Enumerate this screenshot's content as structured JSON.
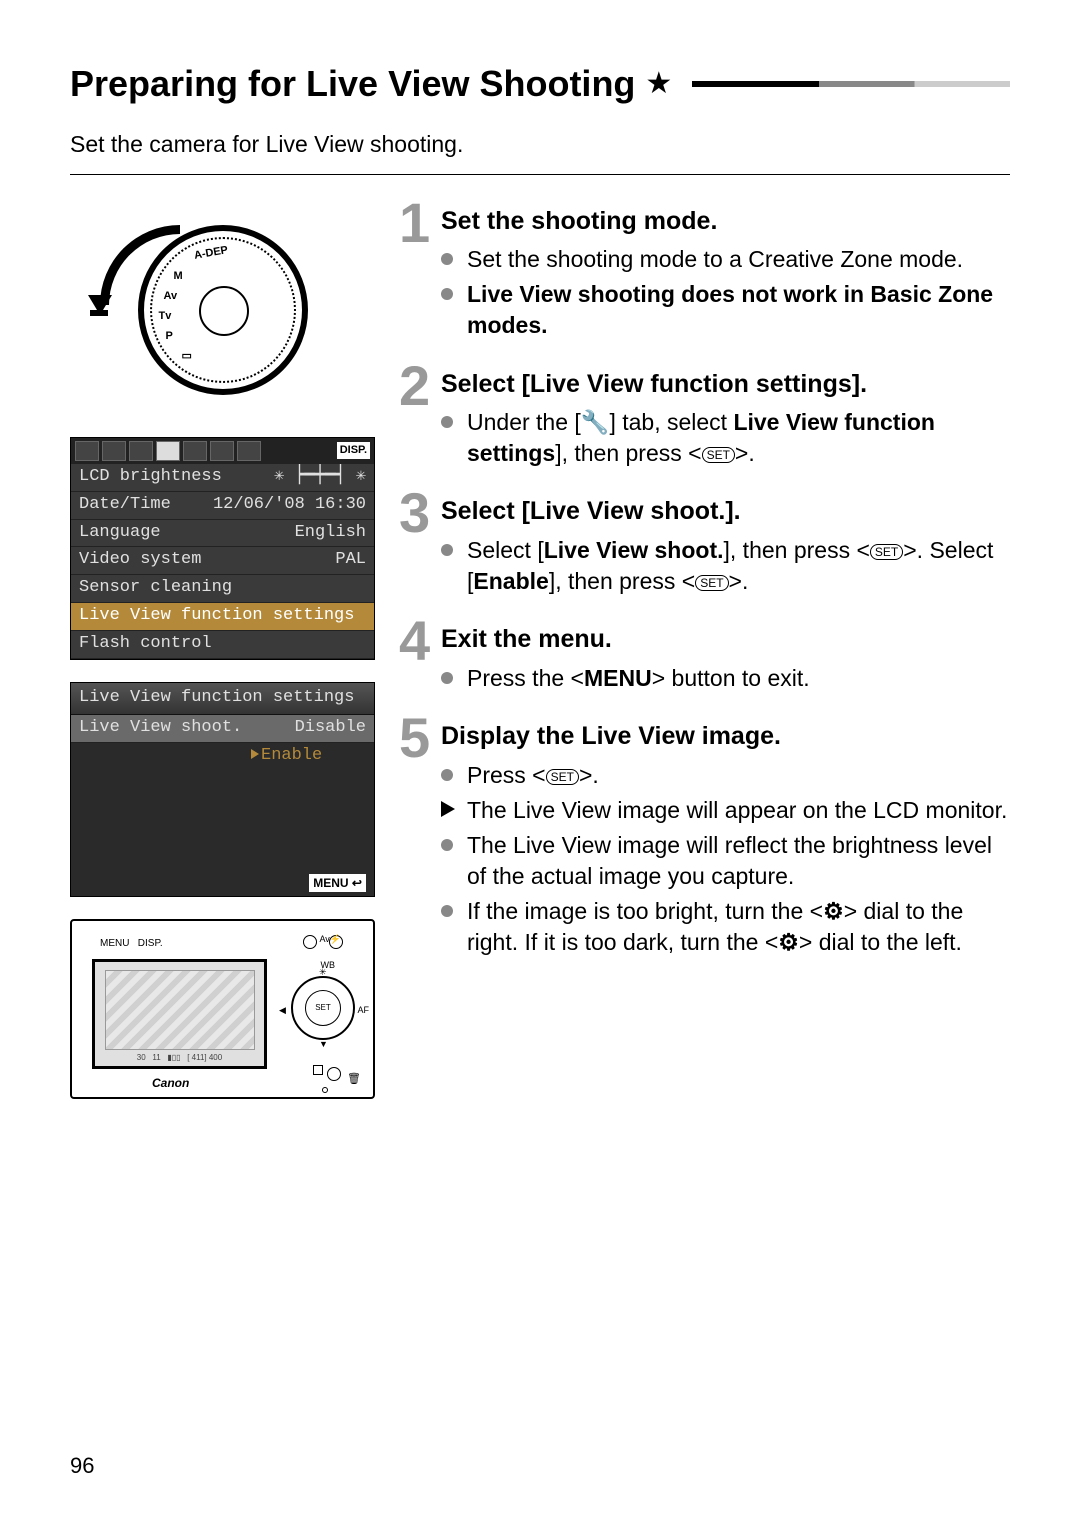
{
  "title": "Preparing for Live View Shooting",
  "intro": "Set the camera for Live View shooting.",
  "page_number": "96",
  "icons": {
    "star": "★",
    "set": "SET",
    "wrench": "🔧",
    "menu": "MENU",
    "dial": "⚙"
  },
  "lcd1": {
    "disp_label": "DISP.",
    "rows": [
      {
        "label": "LCD brightness",
        "value": "✳ ┝━┿━┥ ✳"
      },
      {
        "label": "Date/Time",
        "value": "12/06/'08 16:30"
      },
      {
        "label": "Language",
        "value": "English"
      },
      {
        "label": "Video system",
        "value": "PAL"
      },
      {
        "label": "Sensor cleaning",
        "value": ""
      },
      {
        "label": "Live View function settings",
        "value": "",
        "highlight": true
      },
      {
        "label": "Flash control",
        "value": ""
      }
    ]
  },
  "lcd2": {
    "title": "Live View function settings",
    "row_label": "Live View shoot.",
    "row_value": "Disable",
    "option": "Enable",
    "menu_label": "MENU ↩"
  },
  "steps": [
    {
      "num": "1",
      "title": "Set the shooting mode.",
      "items": [
        {
          "type": "circle",
          "frags": [
            {
              "t": "Set the shooting mode to a Creative Zone mode."
            }
          ]
        },
        {
          "type": "circle",
          "frags": [
            {
              "t": "Live View shooting does not work in Basic Zone modes.",
              "b": true
            }
          ]
        }
      ]
    },
    {
      "num": "2",
      "title": "Select [Live View function settings].",
      "items": [
        {
          "type": "circle",
          "frags": [
            {
              "t": "Under the ["
            },
            {
              "icon": "wrench"
            },
            {
              "t": "] tab, select "
            },
            {
              "t": "Live View function settings",
              "b": true
            },
            {
              "t": "], then press <"
            },
            {
              "icon": "set"
            },
            {
              "t": ">."
            }
          ]
        }
      ]
    },
    {
      "num": "3",
      "title": "Select [Live View shoot.].",
      "items": [
        {
          "type": "circle",
          "frags": [
            {
              "t": "Select ["
            },
            {
              "t": "Live View shoot.",
              "b": true
            },
            {
              "t": "], then press <"
            },
            {
              "icon": "set"
            },
            {
              "t": ">. Select ["
            },
            {
              "t": "Enable",
              "b": true
            },
            {
              "t": "], then press <"
            },
            {
              "icon": "set"
            },
            {
              "t": ">."
            }
          ]
        }
      ]
    },
    {
      "num": "4",
      "title": "Exit the menu.",
      "items": [
        {
          "type": "circle",
          "frags": [
            {
              "t": "Press the <"
            },
            {
              "icon": "menu"
            },
            {
              "t": "> button to exit."
            }
          ]
        }
      ]
    },
    {
      "num": "5",
      "title": "Display the Live View image.",
      "items": [
        {
          "type": "circle",
          "frags": [
            {
              "t": "Press <"
            },
            {
              "icon": "set"
            },
            {
              "t": ">."
            }
          ]
        },
        {
          "type": "tri",
          "frags": [
            {
              "t": "The Live View image will appear on the LCD monitor."
            }
          ]
        },
        {
          "type": "circle",
          "frags": [
            {
              "t": "The Live View image will reflect the brightness level of the actual image you capture."
            }
          ]
        },
        {
          "type": "circle",
          "frags": [
            {
              "t": "If the image is too bright, turn the <"
            },
            {
              "icon": "dial"
            },
            {
              "t": "> dial to the right. If it is too dark, turn the <"
            },
            {
              "icon": "dial"
            },
            {
              "t": "> dial to the left."
            }
          ]
        }
      ]
    }
  ]
}
